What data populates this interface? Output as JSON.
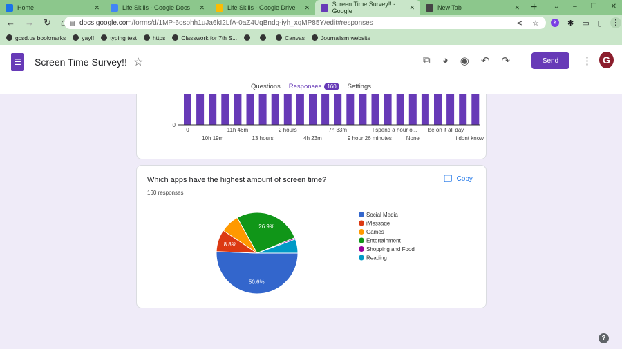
{
  "browser": {
    "tabs": [
      {
        "label": "Home",
        "favicon_color": "#1a73e8",
        "active": false
      },
      {
        "label": "Life Skills - Google Docs",
        "favicon_color": "#4285f4",
        "active": false
      },
      {
        "label": "Life Skills - Google Drive",
        "favicon_color": "#fbbc04",
        "active": false
      },
      {
        "label": "Screen Time Survey!! - Google",
        "favicon_color": "#673ab7",
        "active": true
      },
      {
        "label": "New Tab",
        "favicon_color": "#444444",
        "active": false
      }
    ],
    "url_host": "docs.google.com",
    "url_path": "/forms/d/1MP-6osohh1uJa6kI2LfA-0aZ4UqBndg-iyh_xqMP85Y/edit#responses",
    "bookmarks": [
      "gcsd.us bookmarks",
      "yay!!",
      "typing test",
      "https",
      "Classwork for 7th S...",
      "",
      "",
      "Canvas",
      "Journalism website"
    ]
  },
  "header": {
    "title": "Screen Time Survey!!",
    "send_label": "Send",
    "avatar_letter": "G",
    "tabs": [
      {
        "label": "Questions"
      },
      {
        "label": "Responses",
        "badge": "160"
      },
      {
        "label": "Settings"
      }
    ]
  },
  "chart_data": [
    {
      "type": "bar",
      "color": "#673ab7",
      "categories": [
        "0",
        "",
        "10h 19m",
        "",
        "11h 46m",
        "",
        "13 hours",
        "",
        "2 hours",
        "",
        "4h 23m",
        "",
        "7h 33m",
        "",
        "9 hour 26 minutes",
        "",
        "I spend a hour o...",
        "",
        "None",
        "",
        "i be on it all day",
        "",
        "i dont know",
        ""
      ],
      "values": [
        1,
        1,
        1,
        1,
        1,
        1,
        1,
        1,
        1,
        1,
        1,
        1,
        1,
        1,
        1,
        1,
        1,
        1,
        1,
        1,
        1,
        1,
        1,
        1
      ],
      "yticks": [
        "0"
      ]
    },
    {
      "type": "pie",
      "title": "Which apps have the highest amount of screen time?",
      "subtitle": "160 responses",
      "legend": "right",
      "slices": [
        {
          "name": "Social Media",
          "value": 50.6,
          "label": "50.6%",
          "color": "#3366cc"
        },
        {
          "name": "iMessage",
          "value": 8.8,
          "label": "8.8%",
          "color": "#dc3912"
        },
        {
          "name": "Games",
          "value": 7.5,
          "label": "",
          "color": "#ff9900"
        },
        {
          "name": "Entertainment",
          "value": 26.9,
          "label": "26.9%",
          "color": "#109618"
        },
        {
          "name": "Shopping and Food",
          "value": 0.6,
          "label": "",
          "color": "#990099"
        },
        {
          "name": "Reading",
          "value": 5.6,
          "label": "",
          "color": "#0099c6"
        }
      ]
    }
  ],
  "card2": {
    "question": "Which apps have the highest amount of screen time?",
    "responses": "160 responses",
    "copy_label": "Copy"
  }
}
